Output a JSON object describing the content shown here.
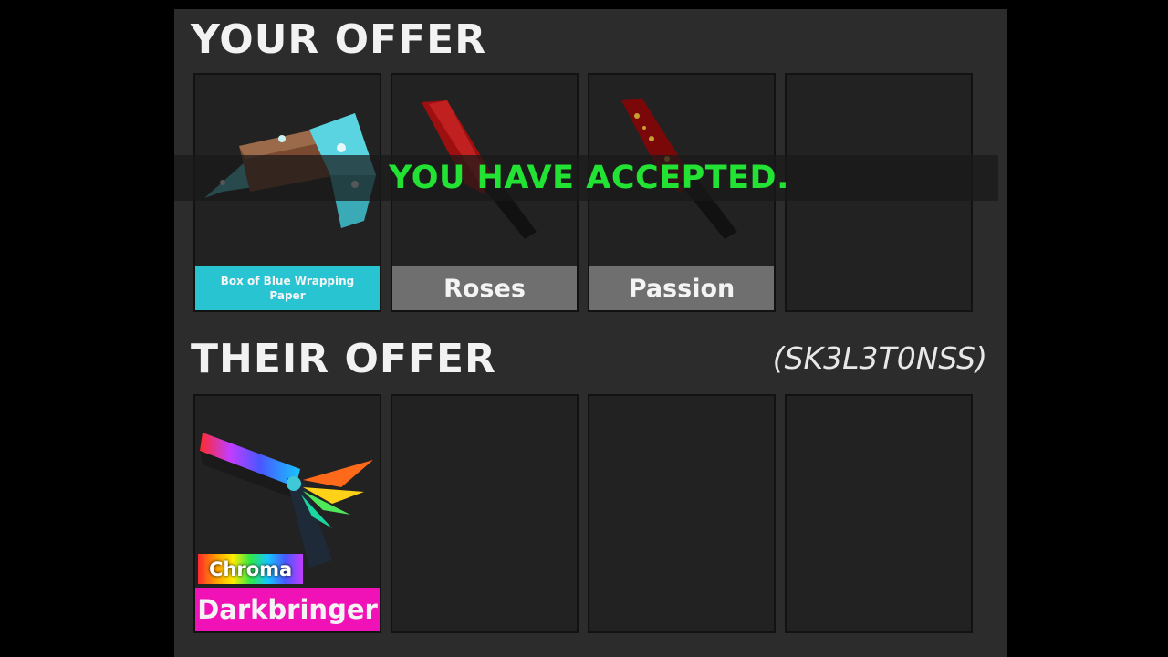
{
  "your_offer": {
    "heading": "YOUR OFFER",
    "slots": [
      {
        "name": "Box of Blue Wrapping Paper",
        "label_color": "#29c4d2",
        "icon": "blue-gift-box-icon"
      },
      {
        "name": "Roses",
        "label_color": "#6f6f6f",
        "icon": "red-knife-icon"
      },
      {
        "name": "Passion",
        "label_color": "#6f6f6f",
        "icon": "red-knife-icon"
      },
      {
        "name": ""
      }
    ]
  },
  "status_banner": {
    "text": "YOU HAVE ACCEPTED.",
    "color": "#22e233"
  },
  "their_offer": {
    "heading": "THEIR OFFER",
    "partner": "(SK3L3T0NSS)",
    "slots": [
      {
        "name": "Darkbringer",
        "badge": "Chroma",
        "label_color": "#f012b6",
        "icon": "rainbow-gun-icon"
      },
      {
        "name": ""
      },
      {
        "name": ""
      },
      {
        "name": ""
      }
    ]
  }
}
